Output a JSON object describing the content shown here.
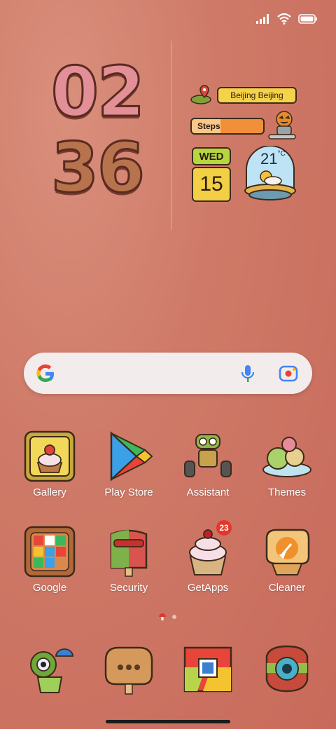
{
  "status_bar": {
    "icons": [
      "signal-icon",
      "wifi-icon",
      "battery-icon"
    ]
  },
  "clock": {
    "hour_1": "0",
    "hour_2": "2",
    "minute_1": "3",
    "minute_2": "6"
  },
  "widget": {
    "location": "Beijing Beijing",
    "steps_label": "Steps",
    "day": "WED",
    "date": "15",
    "temperature": "21",
    "temperature_unit": "°C"
  },
  "search": {
    "icons": [
      "google-icon",
      "mic-icon",
      "lens-icon"
    ]
  },
  "apps": [
    {
      "label": "Gallery"
    },
    {
      "label": "Play Store"
    },
    {
      "label": "Assistant"
    },
    {
      "label": "Themes"
    },
    {
      "label": "Google"
    },
    {
      "label": "Security"
    },
    {
      "label": "GetApps",
      "badge": "23"
    },
    {
      "label": "Cleaner"
    }
  ],
  "dock": [
    "phone-icon",
    "messages-icon",
    "chrome-icon",
    "camera-icon"
  ],
  "colors": {
    "accent_yellow": "#f4d24a",
    "badge_red": "#e2372b",
    "background": "#cf7a68"
  }
}
